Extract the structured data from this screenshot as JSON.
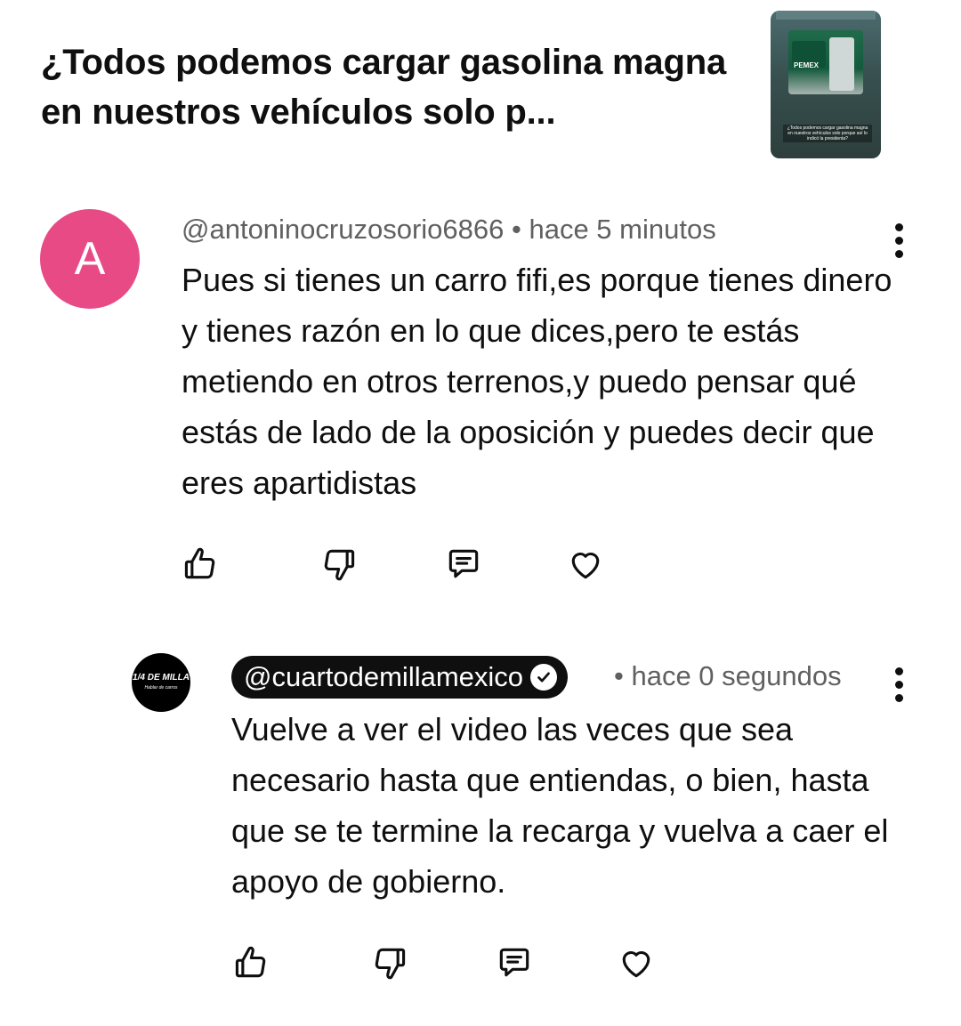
{
  "video": {
    "title": "¿Todos podemos cargar gasolina magna en nuestros vehículos solo p...",
    "thumbnail": {
      "logo_text": "PEMEX",
      "caption": "¿Todos podemos cargar gasolina magna en nuestros vehículos solo porque así lo indicó la presidenta?"
    }
  },
  "comment": {
    "avatar_letter": "A",
    "avatar_color": "#e84a86",
    "author": "@antoninocruzosorio6866",
    "separator": " • ",
    "time": "hace 5 minutos",
    "text": "Pues si tienes un carro fifi,es porque tienes dinero y tienes razón en lo que dices,pero te estás metiendo en otros terrenos,y puedo pensar qué estás de lado de la oposición y puedes decir que eres apartidistas",
    "actions": [
      "like-icon",
      "dislike-icon",
      "reply-icon",
      "heart-icon"
    ]
  },
  "reply": {
    "avatar_text": "1/4 DE MILLA",
    "avatar_subtext": "Hablar de carros",
    "author": "@cuartodemillamexico",
    "verified": true,
    "separator": " • ",
    "time": "hace 0 segundos",
    "text": "Vuelve a ver el video las veces que sea necesario hasta que entiendas, o bien, hasta que se te termine la recarga y vuelva a caer el apoyo de gobierno.",
    "actions": [
      "like-icon",
      "dislike-icon",
      "reply-icon",
      "heart-icon"
    ]
  }
}
